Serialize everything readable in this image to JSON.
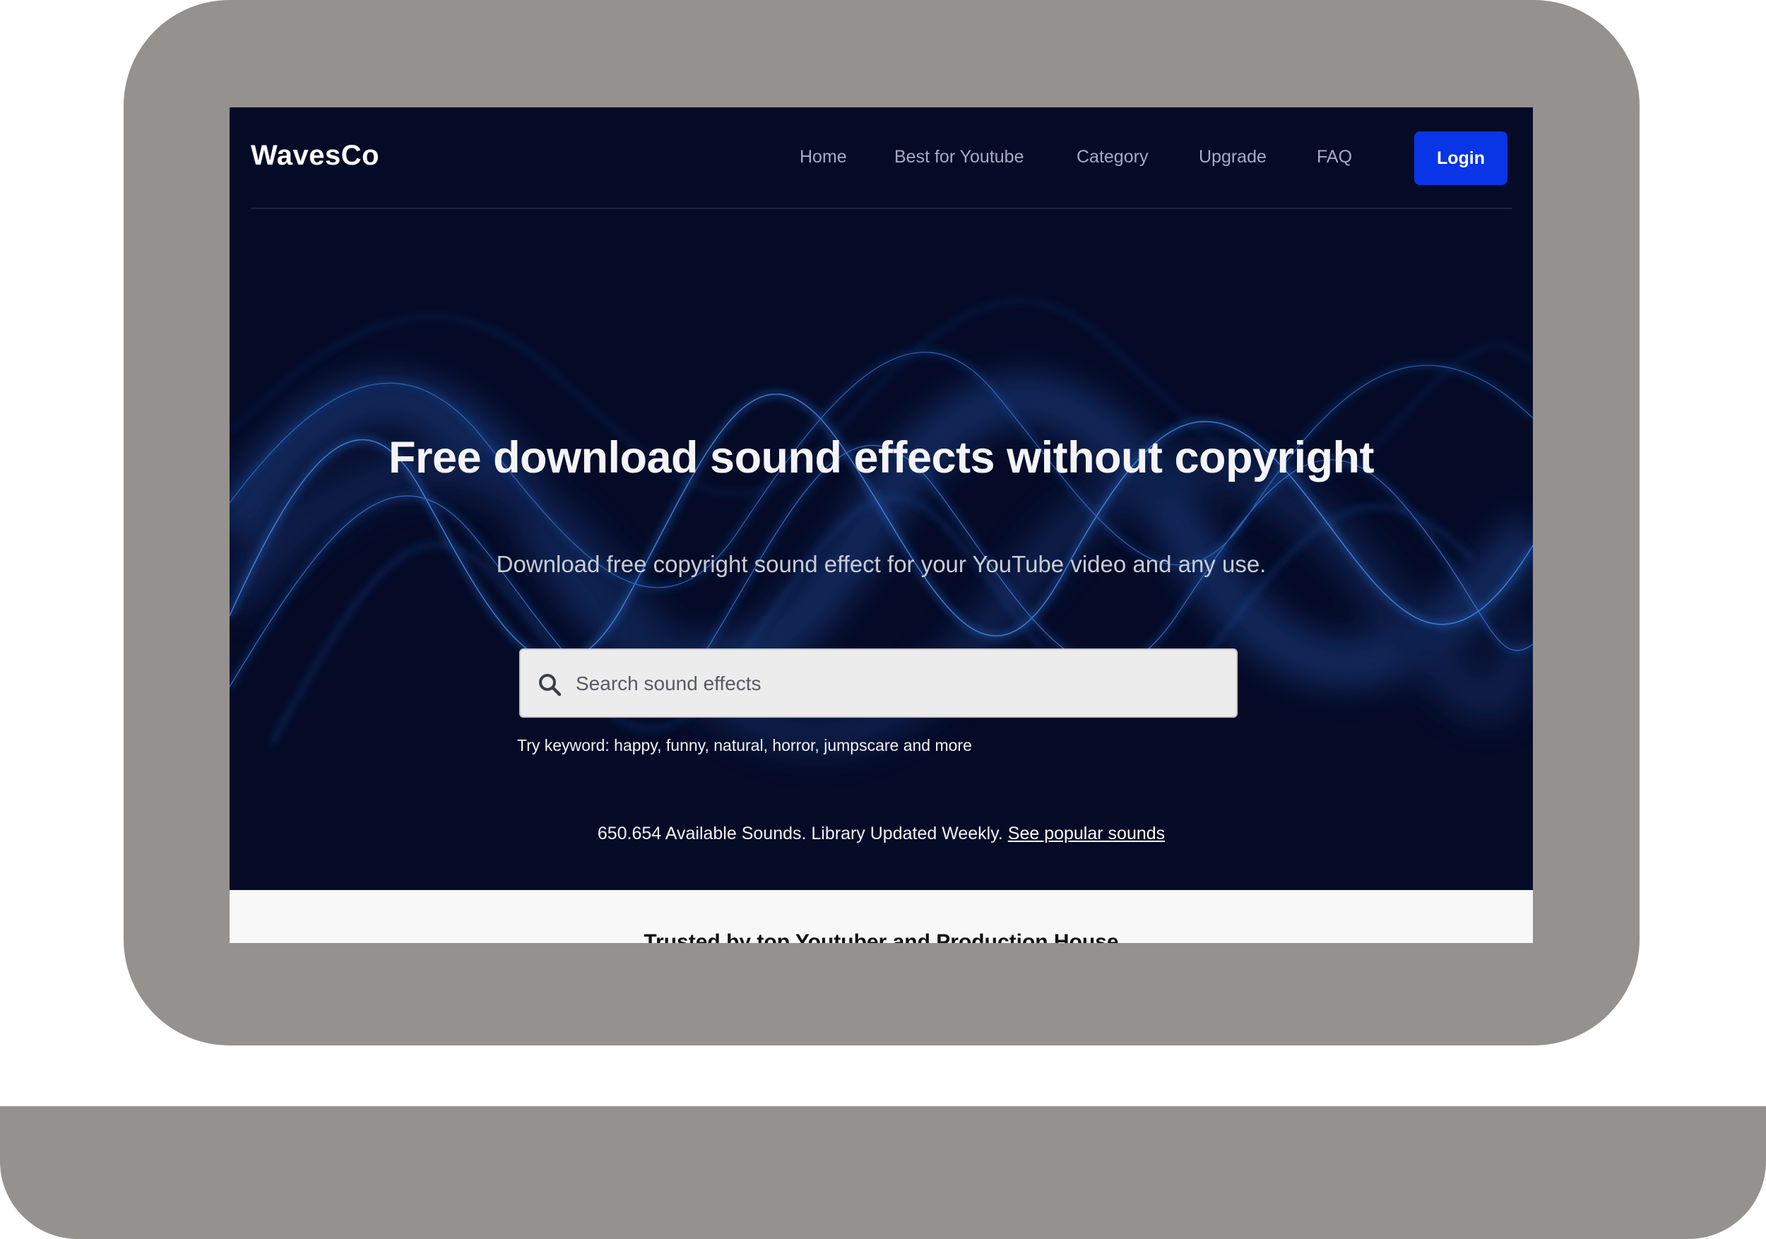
{
  "brand": {
    "logo_text": "WavesCo"
  },
  "nav": {
    "links": [
      "Home",
      "Best for Youtube",
      "Category",
      "Upgrade",
      "FAQ"
    ],
    "login_label": "Login"
  },
  "hero": {
    "headline": "Free download sound effects without copyright",
    "subline": "Download free copyright sound effect for your YouTube video and any use.",
    "search": {
      "placeholder": "Search sound effects",
      "value": "",
      "icon": "search-icon"
    },
    "hint": "Try keyword: happy, funny, natural, horror, jumpscare and more",
    "stats_text": "650.654 Available Sounds. Library Updated Weekly. ",
    "stats_link": "See popular sounds"
  },
  "trusted": {
    "title": "Trusted by top Youtuber and Production House"
  },
  "colors": {
    "hero_bg": "#050b27",
    "accent": "#0a35e6",
    "device_frame": "#95918e"
  }
}
